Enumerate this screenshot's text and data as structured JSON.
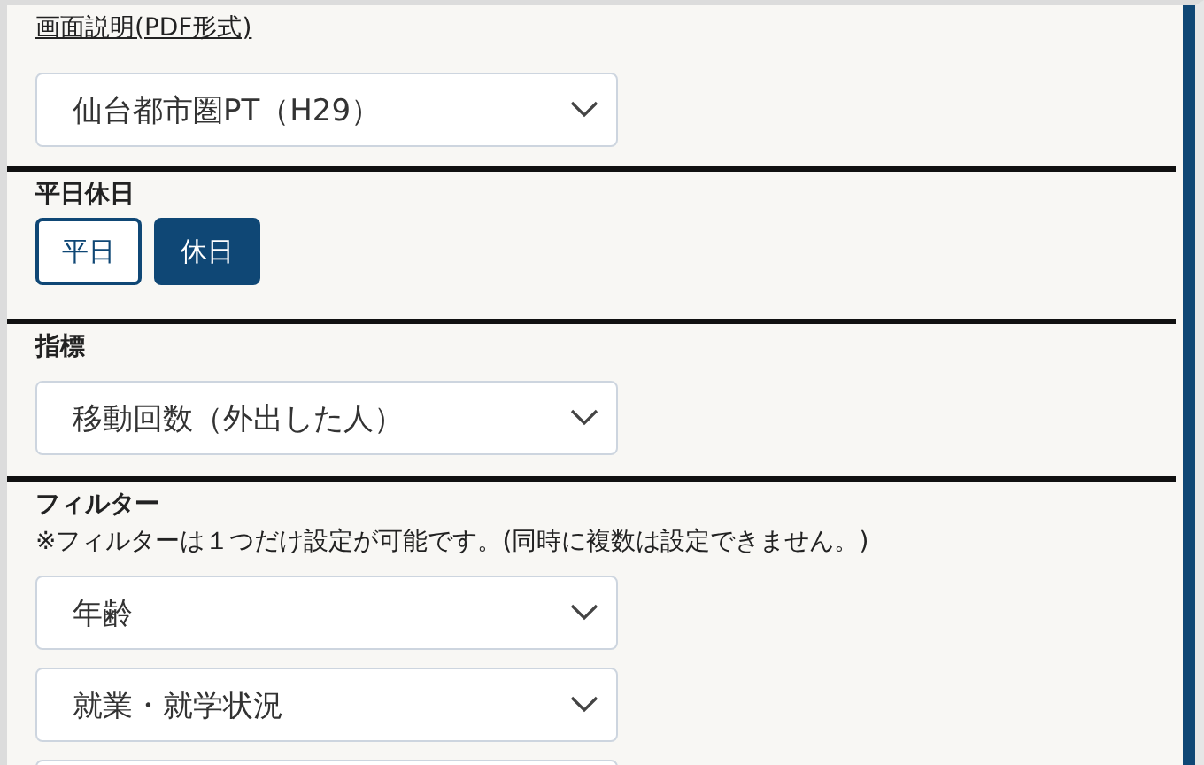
{
  "doc_link": "画面説明(PDF形式)",
  "survey_select": {
    "value": "仙台都市圏PT（H29）"
  },
  "day_type": {
    "label": "平日休日",
    "options": [
      {
        "label": "平日",
        "selected": false
      },
      {
        "label": "休日",
        "selected": true
      }
    ]
  },
  "indicator": {
    "label": "指標",
    "select": {
      "value": "移動回数（外出した人）"
    }
  },
  "filter": {
    "label": "フィルター",
    "note": "※フィルターは１つだけ設定が可能です。(同時に複数は設定できません。)",
    "selects": [
      {
        "value": "年齢"
      },
      {
        "value": "就業・就学状況"
      },
      {
        "kind": "cut_off"
      }
    ]
  }
}
